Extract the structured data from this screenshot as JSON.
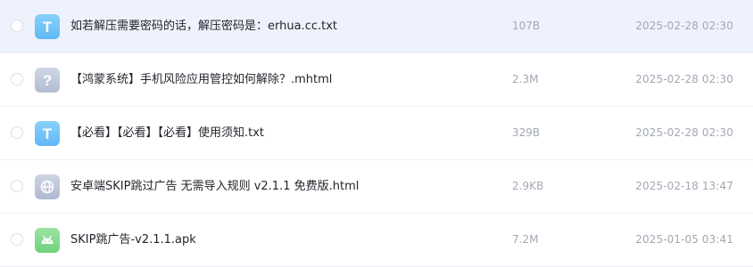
{
  "files": [
    {
      "name": "如若解压需要密码的话，解压密码是：erhua.cc.txt",
      "size": "107B",
      "date": "2025-02-28 02:30",
      "icon": "txt-file-icon",
      "selected": true
    },
    {
      "name": "【鸿蒙系统】手机风险应用管控如何解除？.mhtml",
      "size": "2.3M",
      "date": "2025-02-28 02:30",
      "icon": "unknown-file-icon",
      "selected": false
    },
    {
      "name": "【必看】【必看】【必看】使用须知.txt",
      "size": "329B",
      "date": "2025-02-28 02:30",
      "icon": "txt-file-icon",
      "selected": false
    },
    {
      "name": "安卓端SKIP跳过广告 无需导入规则 v2.1.1 免费版.html",
      "size": "2.9KB",
      "date": "2025-02-18 13:47",
      "icon": "html-file-icon",
      "selected": false
    },
    {
      "name": "SKIP跳广告-v2.1.1.apk",
      "size": "7.2M",
      "date": "2025-01-05 03:41",
      "icon": "apk-file-icon",
      "selected": false
    }
  ],
  "icon_glyphs": {
    "txt": "T",
    "unknown": "?"
  },
  "colors": {
    "selected_row_bg": "#eef2fc",
    "txt_icon": "#6cc0f8",
    "unknown_icon": "#c0c8da",
    "html_icon": "#bdc5d8",
    "apk_icon": "#7fd98a",
    "text_primary": "#1f2329",
    "text_secondary": "#a3a8b3"
  }
}
